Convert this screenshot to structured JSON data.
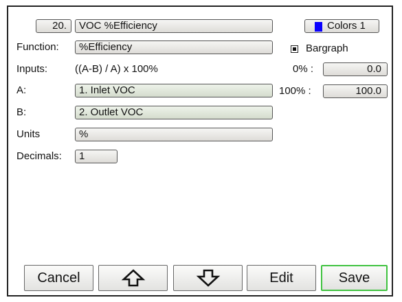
{
  "channel": {
    "number": "20.",
    "name": "VOC %Efficiency"
  },
  "colors_button": {
    "label": "Colors 1",
    "swatch_color": "#0a00ff"
  },
  "function": {
    "label": "Function:",
    "value": "%Efficiency"
  },
  "bargraph": {
    "label": "Bargraph",
    "checked": true
  },
  "inputs": {
    "label": "Inputs:",
    "formula": "((A-B) / A) x 100%"
  },
  "range": {
    "low_label": "0% :",
    "low_value": "0.0",
    "high_label": "100% :",
    "high_value": "100.0"
  },
  "input_a": {
    "label": "A:",
    "value": "1. Inlet VOC"
  },
  "input_b": {
    "label": "B:",
    "value": "2. Outlet VOC"
  },
  "units": {
    "label": "Units",
    "value": "%"
  },
  "decimals": {
    "label": "Decimals:",
    "value": "1"
  },
  "buttons": {
    "cancel": "Cancel",
    "up_icon": "arrow-up-icon",
    "down_icon": "arrow-down-icon",
    "edit": "Edit",
    "save": "Save",
    "save_border_color": "#3fc23f"
  }
}
